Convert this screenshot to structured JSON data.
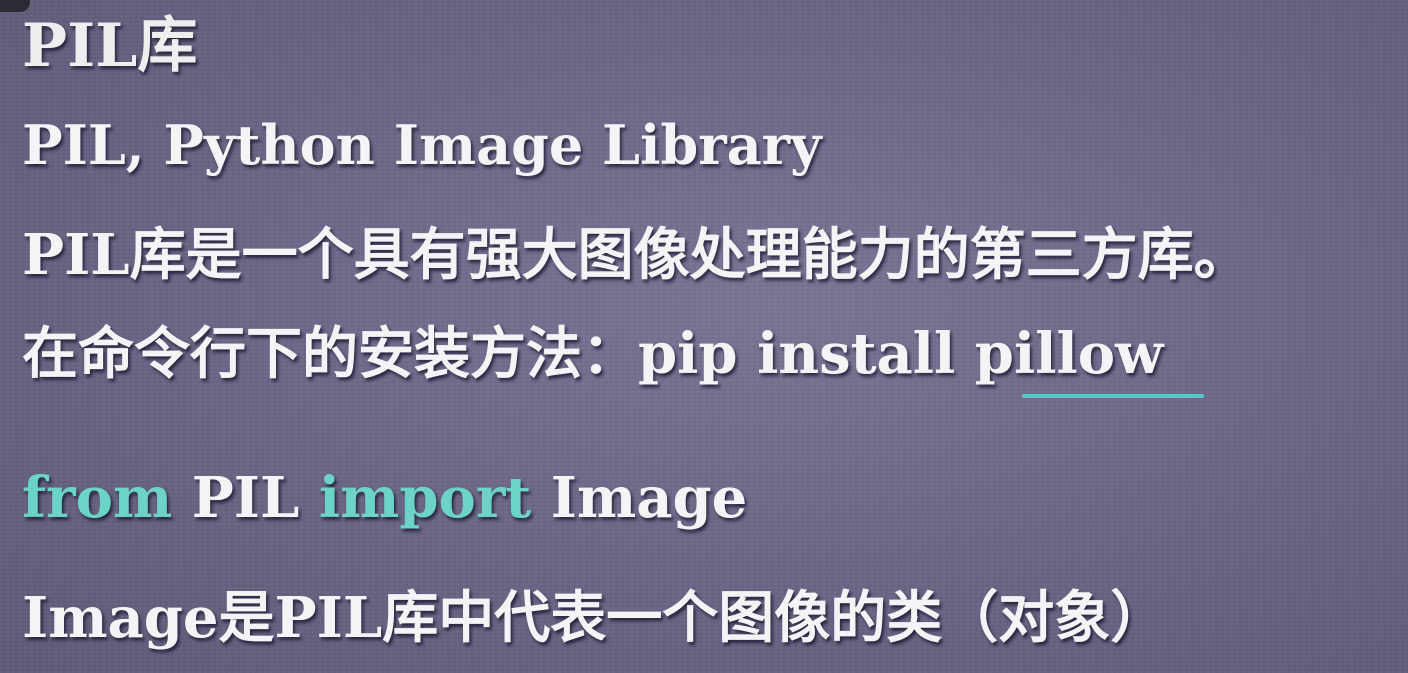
{
  "slide": {
    "title": "PIL库",
    "subtitle": "PIL, Python Image Library",
    "description": "PIL库是一个具有强大图像处理能力的第三方库。",
    "install": {
      "prefix": "在命令行下的安装方法：",
      "command_part1": "pip install ",
      "command_part2": "pillow"
    },
    "import_line": {
      "kw_from": "from",
      "module": " PIL ",
      "kw_import": "import",
      "name": " Image"
    },
    "explanation": "Image是PIL库中代表一个图像的类（对象）"
  },
  "colors": {
    "background": "#6b6584",
    "text": "#f4f4f6",
    "accent": "#6cd3c9",
    "underline": "#57c9c4"
  }
}
